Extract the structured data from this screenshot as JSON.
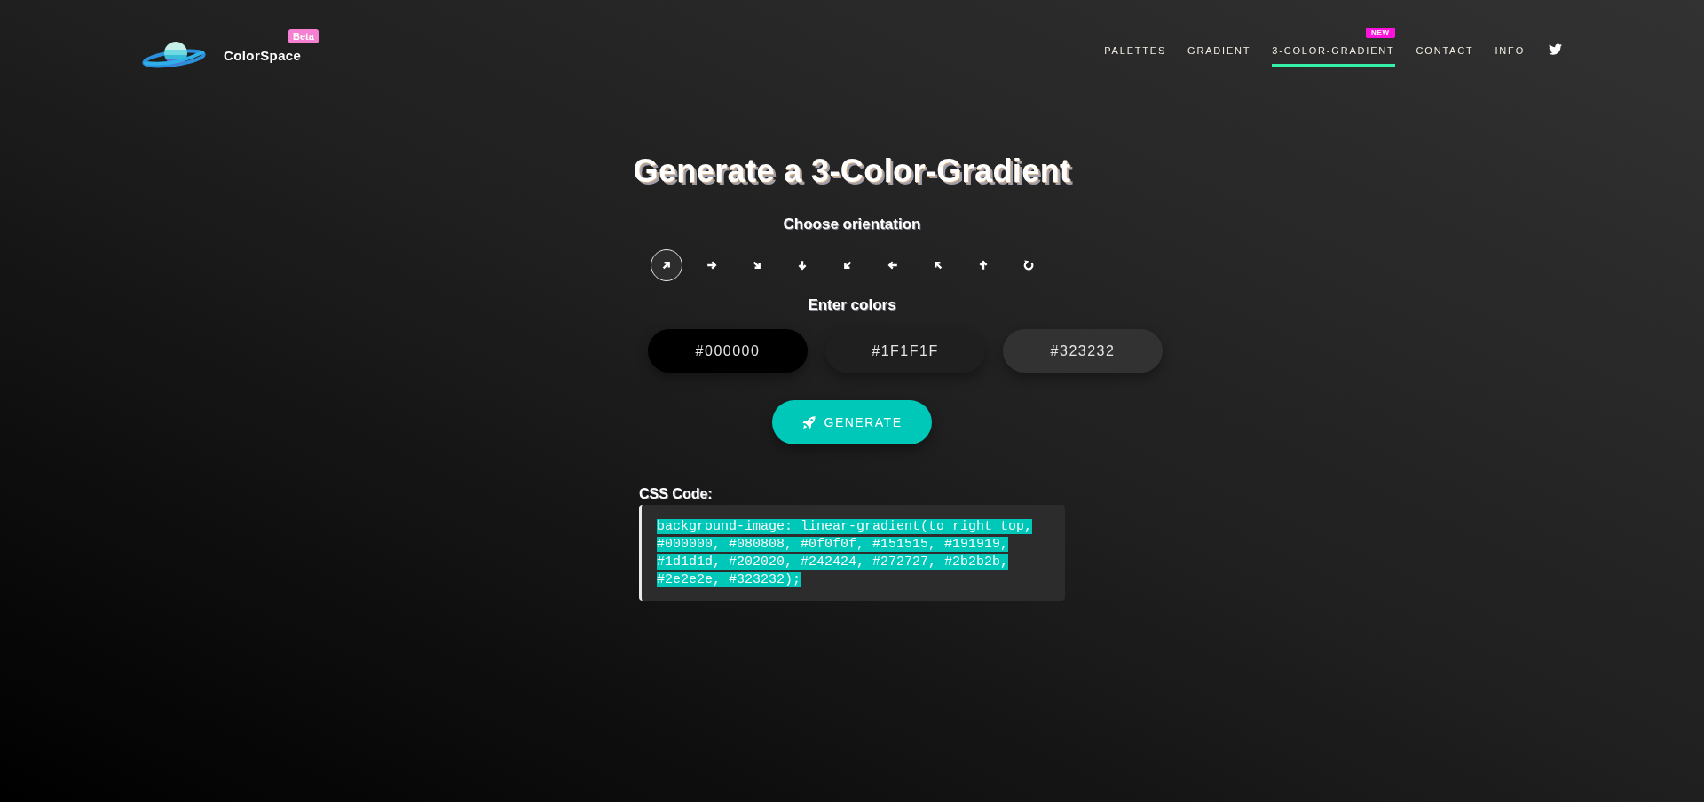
{
  "header": {
    "logo": {
      "name": "ColorSpace",
      "badge": "Beta"
    },
    "nav": [
      {
        "label": "PALETTES",
        "selected": false
      },
      {
        "label": "GRADIENT",
        "selected": false
      },
      {
        "label": "3-COLOR-GRADIENT",
        "selected": true,
        "badge": "NEW"
      },
      {
        "label": "CONTACT",
        "selected": false
      },
      {
        "label": "INFO",
        "selected": false
      }
    ]
  },
  "title": "Generate a 3-Color-Gradient",
  "orientation": {
    "label": "Choose orientation",
    "options": [
      {
        "kind": "up-right",
        "selected": true
      },
      {
        "kind": "right",
        "selected": false
      },
      {
        "kind": "down-right",
        "selected": false
      },
      {
        "kind": "down",
        "selected": false
      },
      {
        "kind": "down-left",
        "selected": false
      },
      {
        "kind": "left",
        "selected": false
      },
      {
        "kind": "up-left",
        "selected": false
      },
      {
        "kind": "up",
        "selected": false
      },
      {
        "kind": "rotate",
        "selected": false
      }
    ]
  },
  "colors": {
    "label": "Enter colors",
    "inputs": [
      {
        "value": "#000000",
        "color": "#000000"
      },
      {
        "value": "#1F1F1F",
        "color": "#1f1f1f"
      },
      {
        "value": "#323232",
        "color": "#323232"
      }
    ]
  },
  "generate_button": {
    "label": "GENERATE"
  },
  "css_code": {
    "label": "CSS Code:",
    "text": "background-image: linear-gradient(to right top, #000000, #080808, #0f0f0f, #151515, #191919, #1d1d1d, #202020, #242424, #272727, #2b2b2b, #2e2e2e, #323232);",
    "selected": true
  }
}
